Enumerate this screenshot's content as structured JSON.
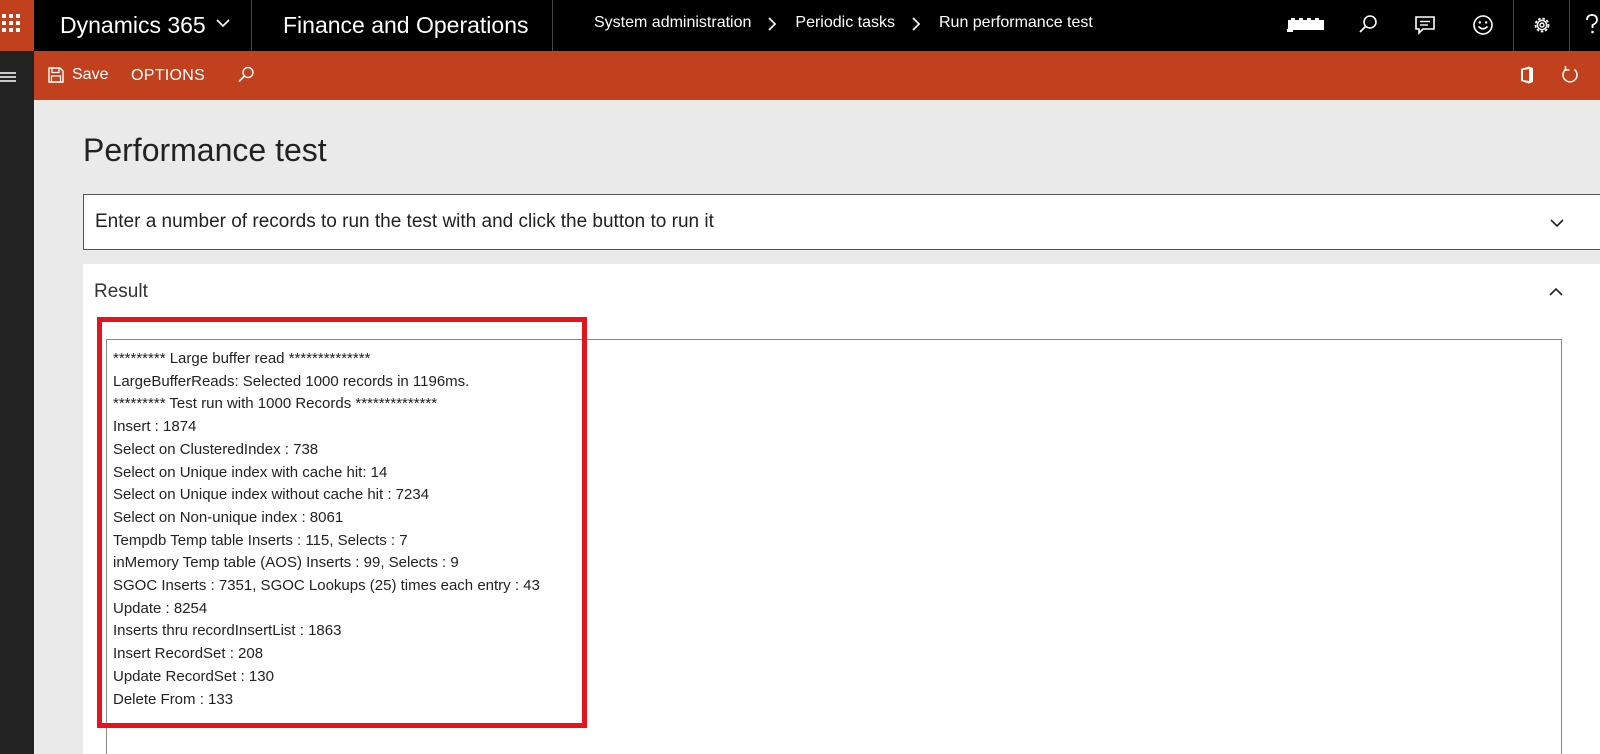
{
  "topbar": {
    "brand": "Dynamics 365",
    "app_name": "Finance and Operations",
    "breadcrumbs": [
      "System administration",
      "Periodic tasks",
      "Run performance test"
    ],
    "icons": [
      "waffle-icon",
      "chevron-down-icon",
      "company-logo",
      "search-icon",
      "message-icon",
      "smiley-icon",
      "gear-icon",
      "help-icon"
    ]
  },
  "actionbar": {
    "save_label": "Save",
    "options_label": "OPTIONS"
  },
  "page": {
    "title": "Performance test",
    "fasttab_instructions": "Enter a number of records to run the test with and click the button to run it",
    "fasttab_result": "Result",
    "result_lines": [
      "********* Large buffer read **************",
      "LargeBufferReads: Selected 1000 records in 1196ms.",
      "********* Test run with 1000 Records **************",
      "Insert : 1874",
      "Select on ClusteredIndex : 738",
      "Select on Unique index with cache hit: 14",
      "Select on Unique index without cache hit : 7234",
      "Select on Non-unique index : 8061",
      "Tempdb Temp table Inserts : 115,  Selects : 7",
      "inMemory Temp table (AOS) Inserts : 99,  Selects : 9",
      "SGOC Inserts : 7351,  SGOC Lookups (25) times each entry : 43",
      "Update  : 8254",
      "Inserts thru recordInsertList : 1863",
      "Insert RecordSet : 208",
      "Update RecordSet : 130",
      "Delete From : 133"
    ]
  },
  "colors": {
    "accent": "#c1411f",
    "topbar": "#000000",
    "highlight": "#e3141b"
  }
}
